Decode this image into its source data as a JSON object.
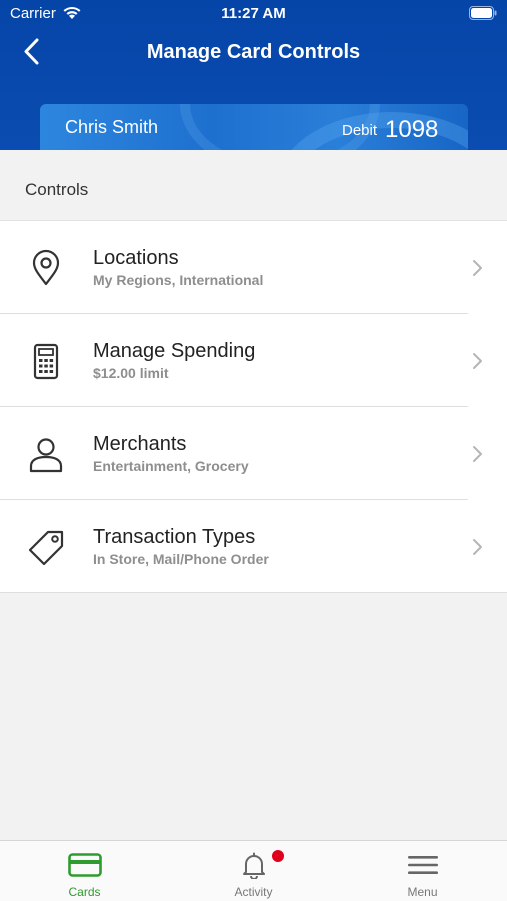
{
  "status_bar": {
    "carrier": "Carrier",
    "time": "11:27 AM"
  },
  "nav": {
    "title": "Manage Card Controls",
    "back_icon": "chevron-left-icon"
  },
  "card": {
    "holder_name": "Chris Smith",
    "type": "Debit",
    "last_digits": "1098"
  },
  "section": {
    "label": "Controls"
  },
  "controls": [
    {
      "title": "Locations",
      "subtitle": "My Regions, International",
      "icon": "map-pin-icon"
    },
    {
      "title": "Manage Spending",
      "subtitle": "$12.00 limit",
      "icon": "calculator-icon"
    },
    {
      "title": "Merchants",
      "subtitle": "Entertainment, Grocery",
      "icon": "person-icon"
    },
    {
      "title": "Transaction Types",
      "subtitle": "In Store, Mail/Phone Order",
      "icon": "tag-icon"
    }
  ],
  "tabs": [
    {
      "label": "Cards",
      "icon": "credit-card-icon",
      "active": true
    },
    {
      "label": "Activity",
      "icon": "bell-icon",
      "badge": true
    },
    {
      "label": "Menu",
      "icon": "hamburger-menu-icon"
    }
  ],
  "colors": {
    "header_blue": "#0645a8",
    "card_blue": "#2d86de",
    "active_tab_green": "#2e9b2e",
    "badge_red": "#e0001b",
    "background": "#f2f2f2"
  }
}
